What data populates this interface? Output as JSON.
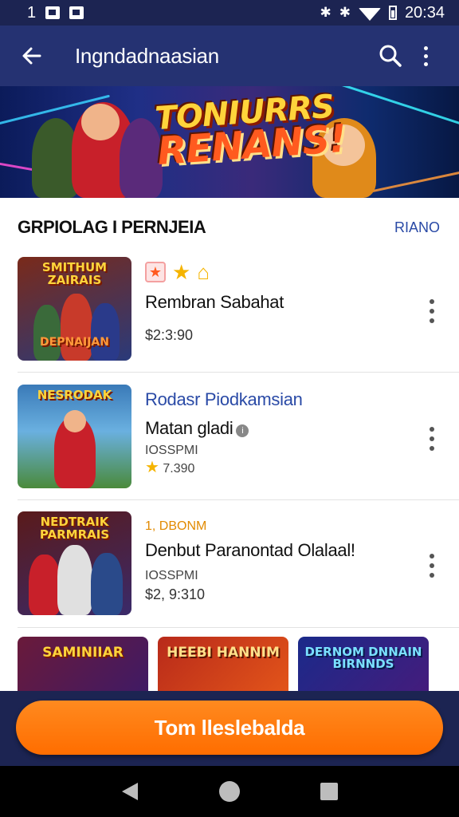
{
  "status_bar": {
    "left_number": "1",
    "time": "20:34"
  },
  "app_bar": {
    "title": "Ingndadnaasian"
  },
  "banner": {
    "line1": "TONIURRS",
    "line2": "RENANS!"
  },
  "section": {
    "title": "GRPIOLAG I PERNJEIA",
    "link": "RIANO"
  },
  "items": [
    {
      "thumb_title_1": "SMITHUM",
      "thumb_title_2": "ZAIRAIS",
      "thumb_caption": "DEPNAIJAN",
      "rating_badge": "★",
      "name": "Rembran Sabahat",
      "price": "$2:3:90",
      "thumb_colors": [
        "#7a2a1a",
        "#2a3a7a"
      ]
    },
    {
      "thumb_title_1": "NESRODAK",
      "headline": "Rodasr Piodkamsian",
      "name": "Matan gladi",
      "meta": "IOSSPMI",
      "rating": "7.390",
      "thumb_colors": [
        "#3a7ab8",
        "#4a8a3a"
      ]
    },
    {
      "thumb_title_1": "NEDTRAIK",
      "thumb_title_2": "PARMRAIS",
      "badge": "1, DBONM",
      "name": "Denbut Paranontad Olalaal!",
      "meta": "IOSSPMI",
      "price": "$2, 9:310",
      "thumb_colors": [
        "#5a1a1a",
        "#3a2a6a"
      ]
    }
  ],
  "tiles": [
    {
      "title": "SAMINIIAR",
      "colors": [
        "#6a1a3a",
        "#3a1a6a"
      ],
      "text_color": "#ffd43b"
    },
    {
      "title": "HEEBI HANNIM",
      "colors": [
        "#b82a1a",
        "#e85a1a"
      ],
      "text_color": "#ffe08a"
    },
    {
      "title": "DERNOM DNNAIN BIRNNDS",
      "colors": [
        "#1a2a8a",
        "#4a1a7a"
      ],
      "text_color": "#7ae0ff"
    }
  ],
  "cta": {
    "label": "Tom lleslebalda"
  },
  "colors": {
    "primary": "#253272",
    "accent": "#ff7a00",
    "link": "#2a4aa6"
  }
}
